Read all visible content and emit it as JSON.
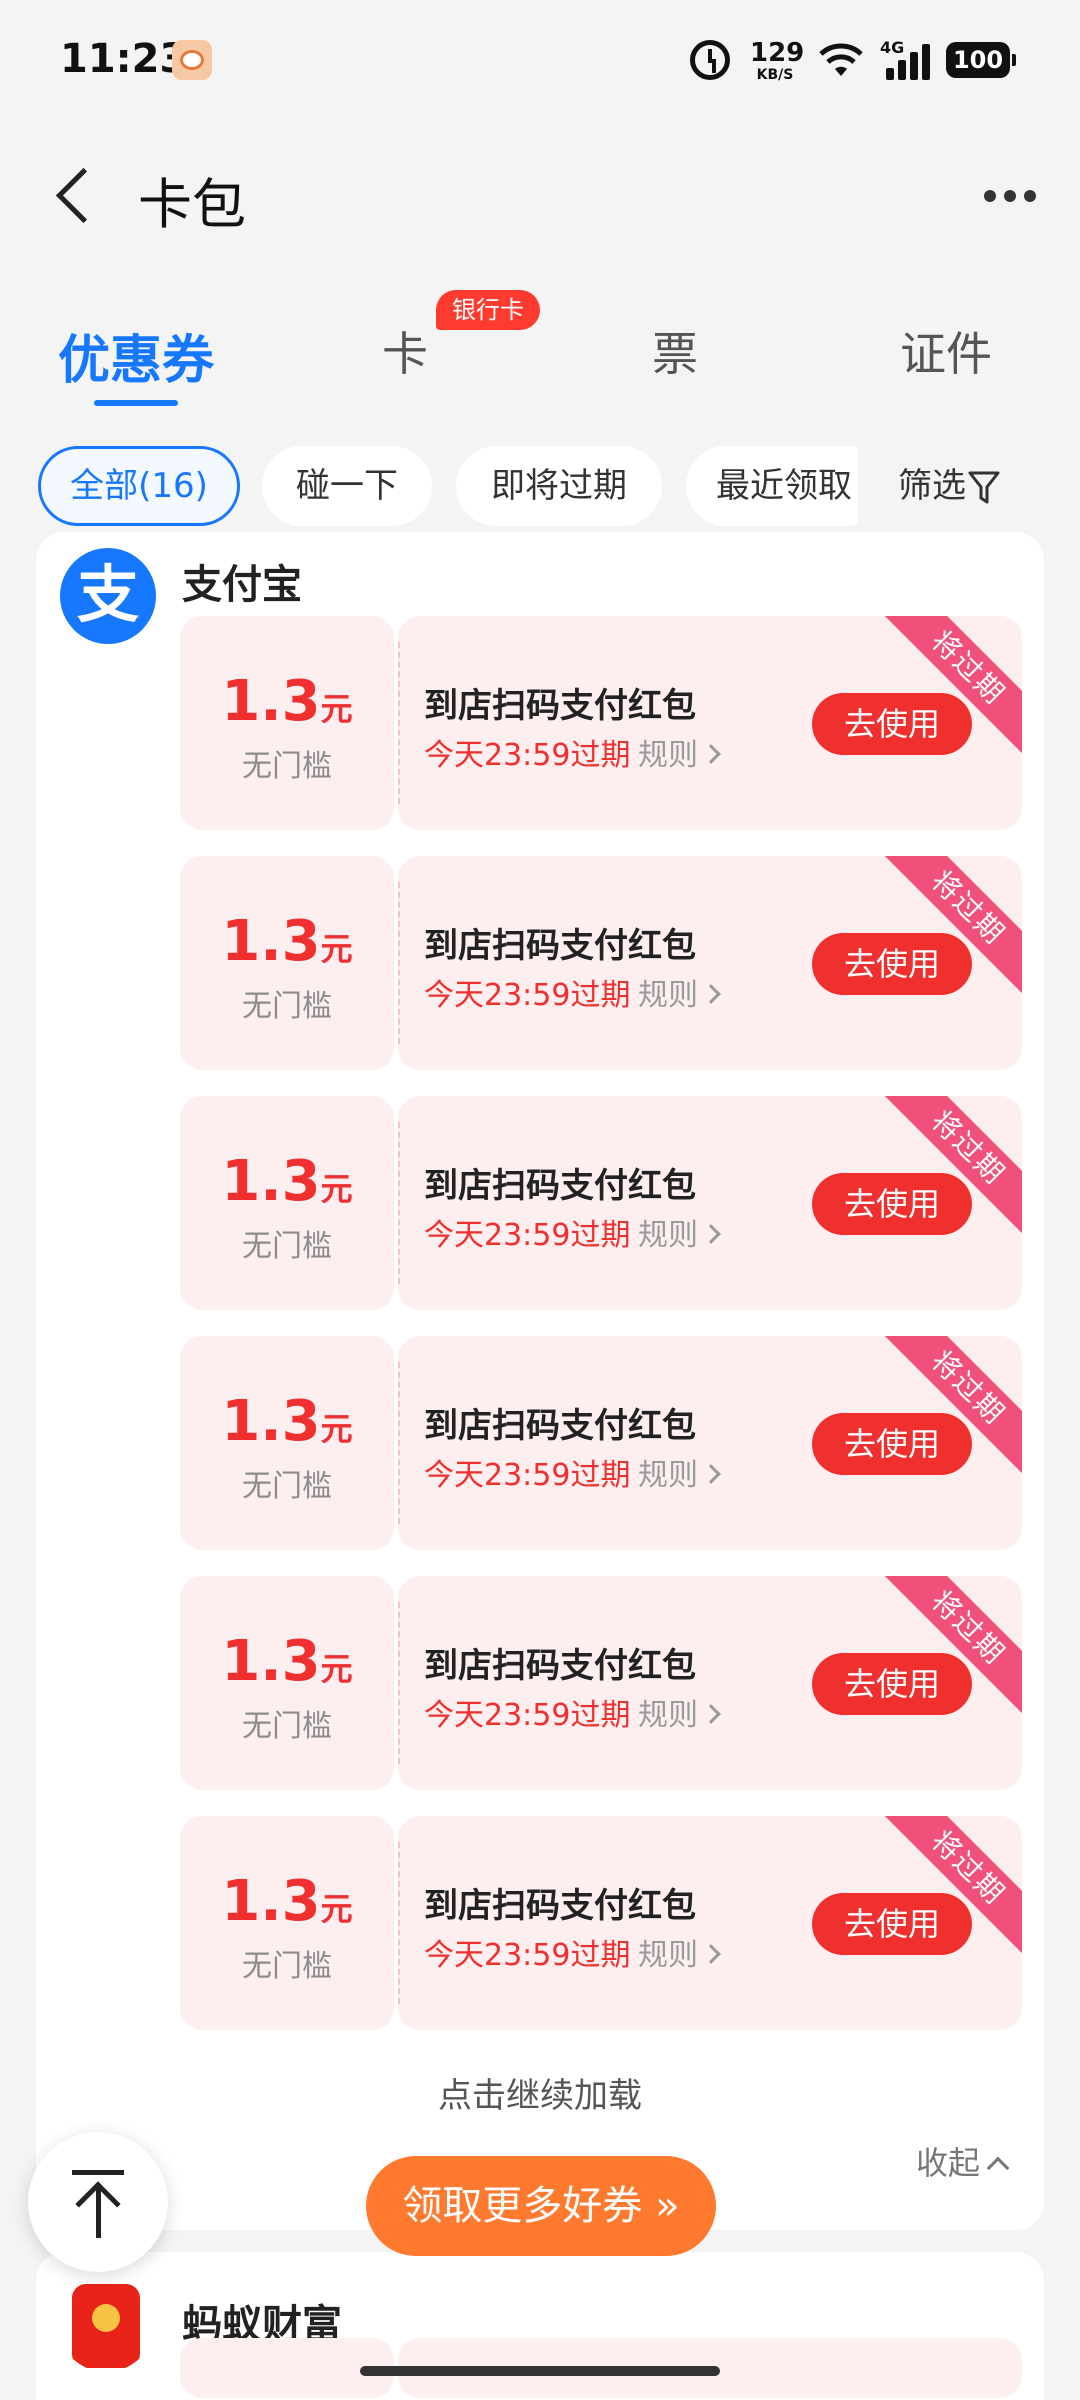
{
  "status_bar": {
    "time": "11:23",
    "net_speed_value": "129",
    "net_speed_unit": "KB/S",
    "network_type": "4G",
    "battery": "100"
  },
  "header": {
    "title": "卡包"
  },
  "tabs": [
    {
      "label": "优惠券",
      "active": true
    },
    {
      "label": "卡",
      "badge": "银行卡"
    },
    {
      "label": "票"
    },
    {
      "label": "证件"
    }
  ],
  "filters": {
    "chips": [
      "全部(16)",
      "碰一下",
      "即将过期",
      "最近领取"
    ],
    "filter_label": "筛选"
  },
  "group": {
    "name": "支付宝",
    "logo_char": "支",
    "coupons": [
      {
        "amount": "1.3",
        "unit": "元",
        "threshold": "无门槛",
        "title": "到店扫码支付红包",
        "expiry": "今天23:59过期",
        "rule": "规则",
        "action": "去使用",
        "ribbon": "将过期"
      },
      {
        "amount": "1.3",
        "unit": "元",
        "threshold": "无门槛",
        "title": "到店扫码支付红包",
        "expiry": "今天23:59过期",
        "rule": "规则",
        "action": "去使用",
        "ribbon": "将过期"
      },
      {
        "amount": "1.3",
        "unit": "元",
        "threshold": "无门槛",
        "title": "到店扫码支付红包",
        "expiry": "今天23:59过期",
        "rule": "规则",
        "action": "去使用",
        "ribbon": "将过期"
      },
      {
        "amount": "1.3",
        "unit": "元",
        "threshold": "无门槛",
        "title": "到店扫码支付红包",
        "expiry": "今天23:59过期",
        "rule": "规则",
        "action": "去使用",
        "ribbon": "将过期"
      },
      {
        "amount": "1.3",
        "unit": "元",
        "threshold": "无门槛",
        "title": "到店扫码支付红包",
        "expiry": "今天23:59过期",
        "rule": "规则",
        "action": "去使用",
        "ribbon": "将过期"
      },
      {
        "amount": "1.3",
        "unit": "元",
        "threshold": "无门槛",
        "title": "到店扫码支付红包",
        "expiry": "今天23:59过期",
        "rule": "规则",
        "action": "去使用",
        "ribbon": "将过期"
      }
    ],
    "load_more": "点击继续加载",
    "collapse": "收起"
  },
  "more_coupons_button": "领取更多好券 »",
  "group2": {
    "name": "蚂蚁财富"
  },
  "colors": {
    "accent": "#1677ff",
    "coupon_red": "#f0302e",
    "coupon_bg": "#fdeef0",
    "ribbon": "#f0507a",
    "cta_orange": "#ff7a2e"
  },
  "icons": [
    "back-arrow-icon",
    "more-dots-icon",
    "funnel-icon",
    "chevron-right-icon",
    "chevron-up-icon",
    "back-to-top-icon",
    "alarm-icon",
    "wifi-icon",
    "signal-icon",
    "battery-icon"
  ]
}
